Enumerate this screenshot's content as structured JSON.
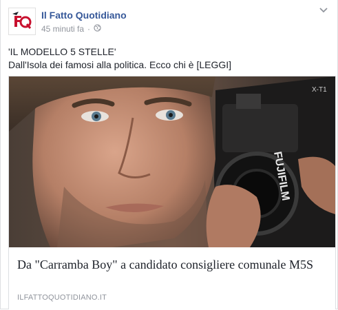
{
  "post": {
    "page_name": "Il Fatto Quotidiano",
    "timestamp": "45 minuti fa",
    "separator": "·",
    "privacy_icon": "globe-icon",
    "avatar_icon": "il-fatto-quotidiano-logo",
    "more_icon": "chevron-down-icon",
    "text_lines": [
      "'IL MODELLO 5 STELLE'",
      "Dall'Isola dei famosi alla politica. Ecco chi è [LEGGI]"
    ]
  },
  "link_card": {
    "image_description_icon": "article-photo",
    "title": "Da \"Carramba Boy\" a candidato consigliere comunale M5S",
    "domain": "ILFATTOQUOTIDIANO.IT",
    "camera_brand_text": "FUJIFILM",
    "camera_model_text": "X-T1"
  },
  "colors": {
    "link_blue": "#365899",
    "meta_gray": "#90949c",
    "text": "#1d2129",
    "border": "#dddfe2",
    "logo_red": "#c8102e"
  }
}
